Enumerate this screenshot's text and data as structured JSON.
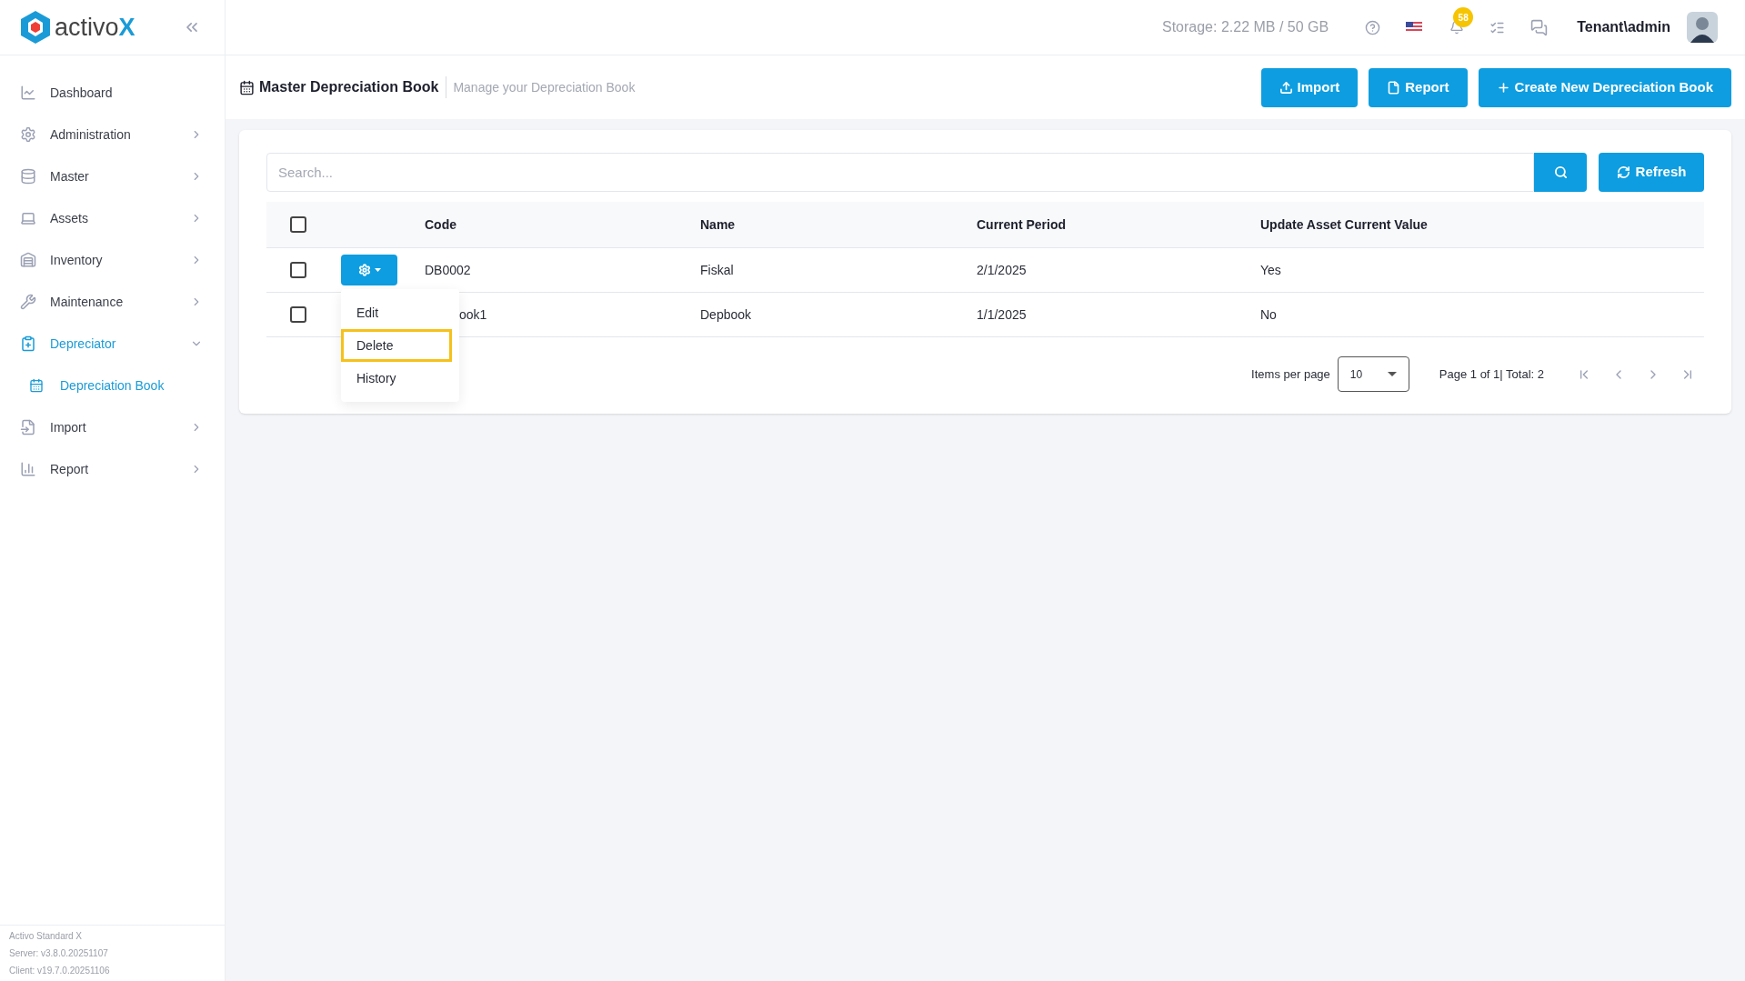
{
  "sidebar": {
    "logo": {
      "text": "activo",
      "accent": "X"
    },
    "items": [
      {
        "label": "Dashboard",
        "has_submenu": false,
        "expanded": false,
        "selected": false
      },
      {
        "label": "Administration",
        "has_submenu": true,
        "expanded": false,
        "selected": false
      },
      {
        "label": "Master",
        "has_submenu": true,
        "expanded": false,
        "selected": false
      },
      {
        "label": "Assets",
        "has_submenu": true,
        "expanded": false,
        "selected": false
      },
      {
        "label": "Inventory",
        "has_submenu": true,
        "expanded": false,
        "selected": false
      },
      {
        "label": "Maintenance",
        "has_submenu": true,
        "expanded": false,
        "selected": false
      },
      {
        "label": "Depreciator",
        "has_submenu": true,
        "expanded": true,
        "selected": true,
        "children": [
          {
            "label": "Depreciation Book",
            "selected": true
          }
        ]
      },
      {
        "label": "Import",
        "has_submenu": true,
        "expanded": false,
        "selected": false
      },
      {
        "label": "Report",
        "has_submenu": true,
        "expanded": false,
        "selected": false
      }
    ],
    "footer": [
      "Activo Standard X",
      "Server: v3.8.0.20251107",
      "Client: v19.7.0.20251106"
    ]
  },
  "header": {
    "storage": "Storage: 2.22 MB / 50 GB",
    "notification_count": "58",
    "user": "Tenant\\admin"
  },
  "page": {
    "title": "Master Depreciation Book",
    "subtitle": "Manage your Depreciation Book",
    "buttons": [
      "Import",
      "Report",
      "Create New Depreciation Book"
    ]
  },
  "search": {
    "placeholder": "Search...",
    "refresh": "Refresh"
  },
  "table": {
    "columns": [
      "Code",
      "Name",
      "Current Period",
      "Update Asset Current Value"
    ],
    "all_checked": false,
    "rows": [
      {
        "checked": false,
        "cells": [
          "DB0002",
          "Fiskal",
          "2/1/2025",
          "Yes"
        ]
      },
      {
        "checked": false,
        "cells": [
          "ook1",
          "Depbook",
          "1/1/2025",
          "No"
        ]
      }
    ]
  },
  "action_menu": {
    "items": [
      {
        "label": "Edit",
        "selected": false
      },
      {
        "label": "Delete",
        "selected": true
      },
      {
        "label": "History",
        "selected": false
      }
    ]
  },
  "pagination": {
    "label": "Items per page",
    "per_page": "10",
    "info": "Page 1 of 1| Total: 2"
  }
}
